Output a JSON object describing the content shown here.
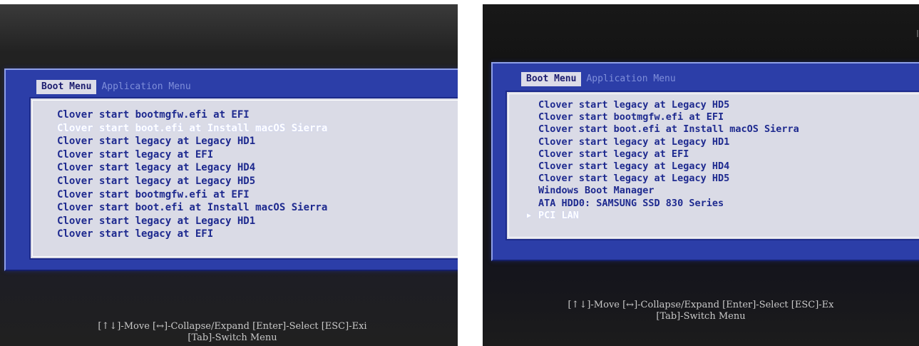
{
  "left_screen": {
    "tabs": [
      {
        "label": "Boot Menu",
        "active": true
      },
      {
        "label": "Application Menu",
        "active": false
      }
    ],
    "menu_items": [
      {
        "label": "Clover start bootmgfw.efi at EFI",
        "selected": false
      },
      {
        "label": "Clover start boot.efi at Install macOS Sierra",
        "selected": true
      },
      {
        "label": "Clover start legacy at Legacy HD1",
        "selected": false
      },
      {
        "label": "Clover start legacy at EFI",
        "selected": false
      },
      {
        "label": "Clover start legacy at Legacy HD4",
        "selected": false
      },
      {
        "label": "Clover start legacy at Legacy HD5",
        "selected": false
      },
      {
        "label": "Clover start bootmgfw.efi at EFI",
        "selected": false
      },
      {
        "label": "Clover start boot.efi at Install macOS Sierra",
        "selected": false
      },
      {
        "label": "Clover start legacy at Legacy HD1",
        "selected": false
      },
      {
        "label": "Clover start legacy at EFI",
        "selected": false
      }
    ],
    "footer_line1": "[↑↓]-Move [↔]-Collapse/Expand [Enter]-Select [ESC]-Exi",
    "footer_line2": "[Tab]-Switch Menu"
  },
  "right_screen": {
    "tabs": [
      {
        "label": "Boot Menu",
        "active": true
      },
      {
        "label": "Application Menu",
        "active": false
      }
    ],
    "menu_items": [
      {
        "label": "Clover start legacy at Legacy HD5",
        "selected": false
      },
      {
        "label": "Clover start bootmgfw.efi at EFI",
        "selected": false
      },
      {
        "label": "Clover start boot.efi at Install macOS Sierra",
        "selected": false
      },
      {
        "label": "Clover start legacy at Legacy HD1",
        "selected": false
      },
      {
        "label": "Clover start legacy at EFI",
        "selected": false
      },
      {
        "label": "Clover start legacy at Legacy HD4",
        "selected": false
      },
      {
        "label": "Clover start legacy at Legacy HD5",
        "selected": false
      },
      {
        "label": "Windows Boot Manager",
        "selected": false
      },
      {
        "label": "ATA HDD0: SAMSUNG SSD 830 Series",
        "selected": false
      },
      {
        "label": "PCI LAN",
        "selected": true,
        "arrow": "▶"
      }
    ],
    "footer_line1": "[↑↓]-Move [↔]-Collapse/Expand [Enter]-Select [ESC]-Ex",
    "footer_line2": "[Tab]-Switch Menu"
  },
  "colors": {
    "menu_text": "#1e2a8f",
    "selected_text": "#ffffff",
    "frame_blue": "#2c3ea8",
    "menu_bg": "#dadbe6",
    "footer_text": "#c9c9c9"
  }
}
